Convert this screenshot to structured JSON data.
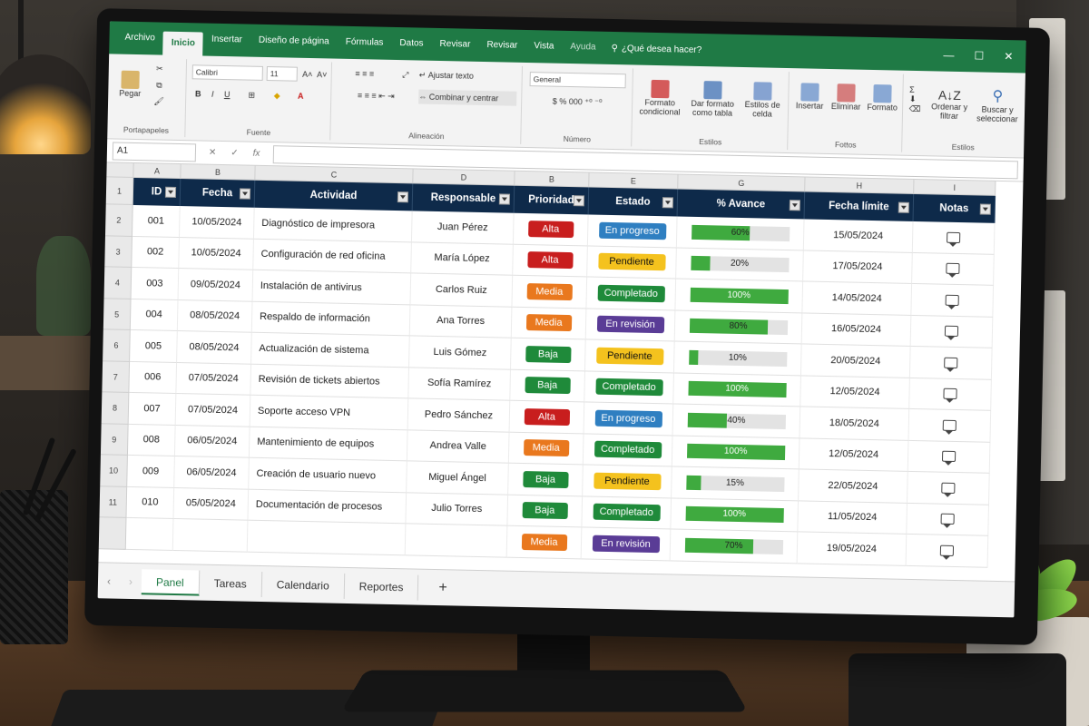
{
  "ribbon_tabs": [
    "Archivo",
    "Inicio",
    "Insertar",
    "Diseño de página",
    "Fórmulas",
    "Datos",
    "Revisar",
    "Revisar",
    "Vista",
    "Ayuda"
  ],
  "tell_me": "¿Qué desea hacer?",
  "ribbon": {
    "paste": "Pegar",
    "clipboard": "Portapapeles",
    "font_name": "Calibri",
    "font_size": "11",
    "font_group": "Fuente",
    "wrap": "Ajustar texto",
    "merge": "Combinar y centrar",
    "alignment_group": "Alineación",
    "number_format": "General",
    "number_group": "Número",
    "cond_format": "Formato condicional",
    "table_format": "Dar formato como tabla",
    "cell_styles": "Estilos de celda",
    "styles_group": "Estilos",
    "insert": "Insertar",
    "delete": "Eliminar",
    "format": "Formato",
    "cells_group": "Fottos",
    "sort_filter": "Ordenar y filtrar",
    "find_select": "Buscar y seleccionar",
    "edit_group": "Estilos"
  },
  "name_box": "A1",
  "column_letters": [
    "A",
    "B",
    "C",
    "D",
    "B",
    "E",
    "G",
    "H",
    "I"
  ],
  "headers": [
    "ID",
    "Fecha",
    "Actividad",
    "Responsable",
    "Prioridad",
    "Estado",
    "% Avance",
    "Fecha límite",
    "Notas"
  ],
  "rows": [
    {
      "num": "2",
      "id": "001",
      "fecha": "10/05/2024",
      "actividad": "Diagnóstico de impresora",
      "responsable": "Juan Pérez",
      "prioridad": "Alta",
      "estado": "En progreso",
      "avance": 60,
      "avance_label": "60%",
      "limite": "15/05/2024"
    },
    {
      "num": "3",
      "id": "002",
      "fecha": "10/05/2024",
      "actividad": "Configuración de red oficina",
      "responsable": "María López",
      "prioridad": "Alta",
      "estado": "Pendiente",
      "avance": 20,
      "avance_label": "20%",
      "limite": "17/05/2024"
    },
    {
      "num": "4",
      "id": "003",
      "fecha": "09/05/2024",
      "actividad": "Instalación de antivirus",
      "responsable": "Carlos Ruiz",
      "prioridad": "Media",
      "estado": "Completado",
      "avance": 100,
      "avance_label": "100%",
      "limite": "14/05/2024"
    },
    {
      "num": "5",
      "id": "004",
      "fecha": "08/05/2024",
      "actividad": "Respaldo de información",
      "responsable": "Ana Torres",
      "prioridad": "Media",
      "estado": "En revisión",
      "avance": 80,
      "avance_label": "80%",
      "limite": "16/05/2024"
    },
    {
      "num": "6",
      "id": "005",
      "fecha": "08/05/2024",
      "actividad": "Actualización de sistema",
      "responsable": "Luis Gómez",
      "prioridad": "Baja",
      "estado": "Pendiente",
      "avance": 10,
      "avance_label": "10%",
      "limite": "20/05/2024"
    },
    {
      "num": "7",
      "id": "006",
      "fecha": "07/05/2024",
      "actividad": "Revisión de tickets abiertos",
      "responsable": "Sofía Ramírez",
      "prioridad": "Baja",
      "estado": "Completado",
      "avance": 100,
      "avance_label": "100%",
      "limite": "12/05/2024"
    },
    {
      "num": "8",
      "id": "007",
      "fecha": "07/05/2024",
      "actividad": "Soporte acceso VPN",
      "responsable": "Pedro Sánchez",
      "prioridad": "Alta",
      "estado": "En progreso",
      "avance": 40,
      "avance_label": "40%",
      "limite": "18/05/2024"
    },
    {
      "num": "9",
      "id": "008",
      "fecha": "06/05/2024",
      "actividad": "Mantenimiento de equipos",
      "responsable": "Andrea Valle",
      "prioridad": "Media",
      "estado": "Completado",
      "avance": 100,
      "avance_label": "100%",
      "limite": "12/05/2024"
    },
    {
      "num": "10",
      "id": "009",
      "fecha": "06/05/2024",
      "actividad": "Creación de usuario nuevo",
      "responsable": "Miguel Ángel",
      "prioridad": "Baja",
      "estado": "Pendiente",
      "avance": 15,
      "avance_label": "15%",
      "limite": "22/05/2024"
    },
    {
      "num": "11",
      "id": "010",
      "fecha": "05/05/2024",
      "actividad": "Documentación de procesos",
      "responsable": "Julio Torres",
      "prioridad": "Baja",
      "estado": "Completado",
      "avance": 100,
      "avance_label": "100%",
      "limite": "11/05/2024"
    },
    {
      "num": "",
      "id": "",
      "fecha": "",
      "actividad": "",
      "responsable": "",
      "prioridad": "Media",
      "estado": "En revisión",
      "avance": 70,
      "avance_label": "70%",
      "limite": "19/05/2024"
    }
  ],
  "priority_colors": {
    "Alta": "#c81e1e",
    "Media": "#e9781e",
    "Baja": "#1f8a3a"
  },
  "status_colors": {
    "En progreso": "#2f7fc1",
    "Pendiente": "#f4c21e",
    "Completado": "#1f8a3a",
    "En revisión": "#5a3c96"
  },
  "sheet_tabs": [
    "Panel",
    "Tareas",
    "Calendario",
    "Reportes"
  ],
  "accent": "#1f7a45",
  "header_color": "#0e2a4a"
}
